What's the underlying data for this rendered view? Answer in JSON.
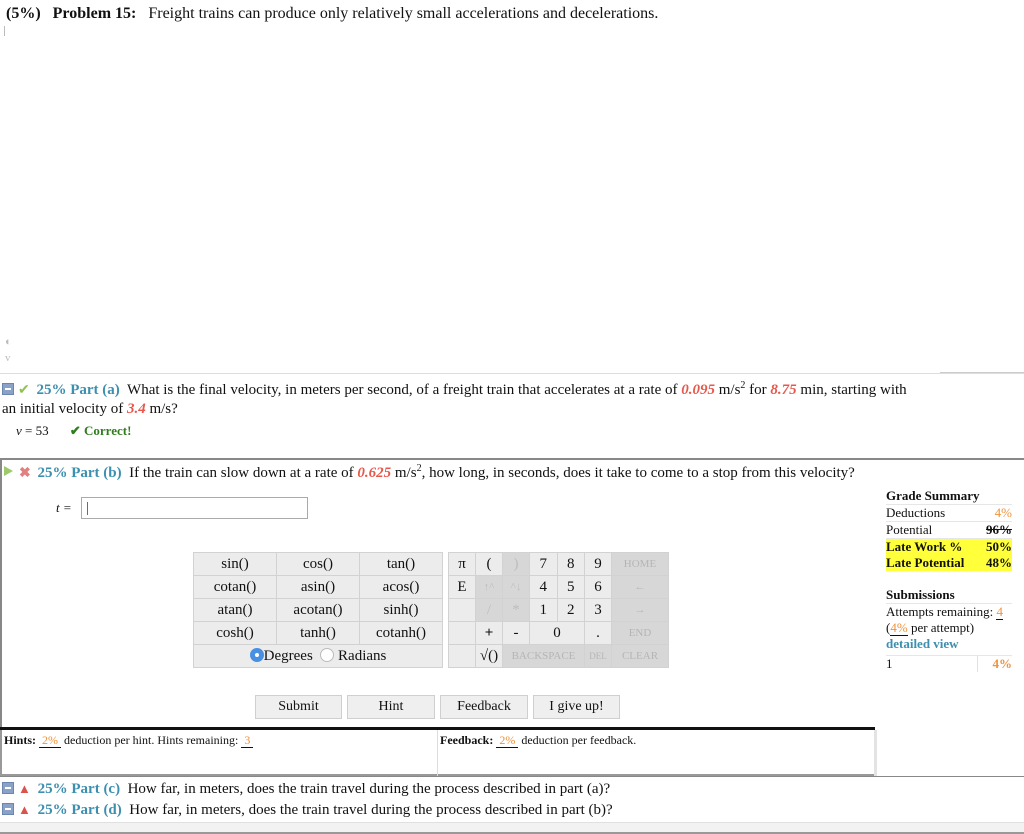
{
  "problem": {
    "weight": "(5%)",
    "label": "Problem 15:",
    "statement": "Freight trains can produce only relatively small accelerations and decelerations."
  },
  "parts": {
    "a": {
      "weight": "25%",
      "label": "Part (a)",
      "status_icon": "check-icon",
      "text_1": "What is the final velocity, in meters per second, of a freight train that accelerates at a rate of",
      "accel": "0.095",
      "unit_accel": "m/s",
      "text_2": "for",
      "time": "8.75",
      "text_3": "min, starting with",
      "text_4": "an initial velocity of",
      "v0": "3.4",
      "text_5": "m/s?",
      "answer_var": "v",
      "answer_eq": " = 53",
      "result": "✔ Correct!"
    },
    "b": {
      "weight": "25%",
      "label": "Part (b)",
      "status_icon": "x-icon",
      "text_1": "If the train can slow down at a rate of",
      "decel": "0.625",
      "unit_accel": "m/s",
      "text_2": ", how long, in seconds, does it take to come to a stop from this velocity?",
      "input_label": "t =",
      "input_value": ""
    },
    "c": {
      "weight": "25%",
      "label": "Part (c)",
      "status_icon": "warning-icon",
      "text": "How far, in meters, does the train travel during the process described in part (a)?"
    },
    "d": {
      "weight": "25%",
      "label": "Part (d)",
      "status_icon": "warning-icon",
      "text": "How far, in meters, does the train travel during the process described in part (b)?"
    }
  },
  "grade_summary": {
    "title": "Grade Summary",
    "deductions_label": "Deductions",
    "deductions_value": "4%",
    "potential_label": "Potential",
    "potential_value": "96%",
    "late_work_label": "Late Work %",
    "late_work_value": "50%",
    "late_potential_label": "Late Potential",
    "late_potential_value": "48%"
  },
  "submissions": {
    "title": "Submissions",
    "attempts_label": "Attempts remaining:",
    "attempts_value": "4",
    "per_attempt_open": "(",
    "per_attempt_value": "4%",
    "per_attempt_text": " per attempt)",
    "detailed_view": "detailed view",
    "rows": [
      {
        "attempt": "1",
        "deduction": "4%"
      }
    ]
  },
  "calculator": {
    "functions": [
      [
        "sin()",
        "cos()",
        "tan()"
      ],
      [
        "cotan()",
        "asin()",
        "acos()"
      ],
      [
        "atan()",
        "acotan()",
        "sinh()"
      ],
      [
        "cosh()",
        "tanh()",
        "cotanh()"
      ]
    ],
    "angle_modes": {
      "degrees": "Degrees",
      "radians": "Radians",
      "selected": "Degrees"
    },
    "keys": {
      "pi": "π",
      "open_paren": "(",
      "close_paren": ")",
      "e": "E",
      "up": "↑^",
      "down": "^↓",
      "divide": "/",
      "multiply": "*",
      "plus": "+",
      "minus": "-",
      "sqrt": "√()",
      "dot": ".",
      "d0": "0",
      "d1": "1",
      "d2": "2",
      "d3": "3",
      "d4": "4",
      "d5": "5",
      "d6": "6",
      "d7": "7",
      "d8": "8",
      "d9": "9",
      "home": "HOME",
      "left": "←",
      "right": "→",
      "end": "END",
      "backspace": "BACKSPACE",
      "del": "DEL",
      "clear": "CLEAR"
    }
  },
  "buttons": {
    "submit": "Submit",
    "hint": "Hint",
    "feedback": "Feedback",
    "give_up": "I give up!"
  },
  "hints": {
    "label": "Hints:",
    "deduction": "2%",
    "text": "deduction per hint. Hints remaining:",
    "remaining": "3"
  },
  "feedback": {
    "label": "Feedback:",
    "deduction": "2%",
    "text": "deduction per feedback."
  },
  "colors": {
    "part_label": "#3d8fb0",
    "given_value": "#e8574b",
    "percent_orange": "#f0923a",
    "correct_green": "#2f7d1e",
    "highlight_yellow": "#ffff3a"
  }
}
